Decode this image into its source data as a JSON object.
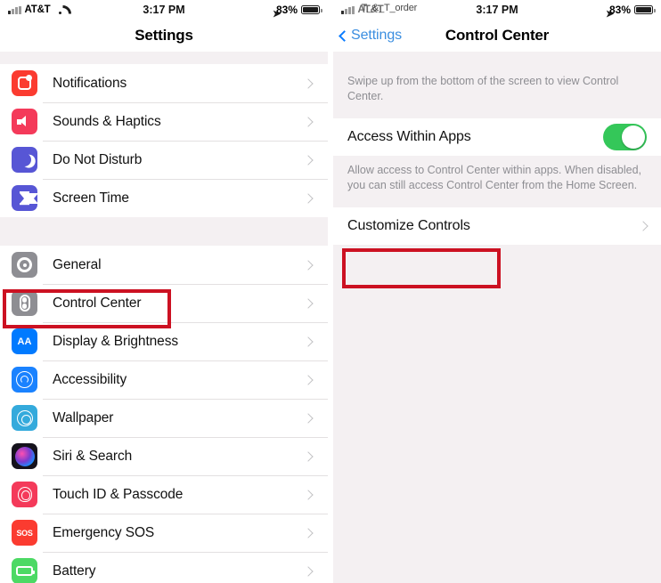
{
  "left": {
    "statusbar": {
      "carrier": "AT&T",
      "time": "3:17 PM",
      "battery_pct": "83%",
      "wifi_icon": "wifi-icon",
      "signal_icon": "cellular-signal-icon",
      "location_icon": "location-arrow-icon",
      "battery_icon": "battery-icon"
    },
    "nav": {
      "title": "Settings"
    },
    "groups": [
      {
        "rows": [
          {
            "label": "Notifications",
            "icon": "notifications-icon",
            "chevron": "chevron-right-icon"
          },
          {
            "label": "Sounds & Haptics",
            "icon": "sounds-icon",
            "chevron": "chevron-right-icon"
          },
          {
            "label": "Do Not Disturb",
            "icon": "do-not-disturb-icon",
            "chevron": "chevron-right-icon"
          },
          {
            "label": "Screen Time",
            "icon": "screen-time-icon",
            "chevron": "chevron-right-icon"
          }
        ]
      },
      {
        "rows": [
          {
            "label": "General",
            "icon": "general-gear-icon",
            "chevron": "chevron-right-icon"
          },
          {
            "label": "Control Center",
            "icon": "control-center-icon",
            "chevron": "chevron-right-icon"
          },
          {
            "label": "Display & Brightness",
            "icon": "display-aa-icon",
            "chevron": "chevron-right-icon"
          },
          {
            "label": "Accessibility",
            "icon": "accessibility-icon",
            "chevron": "chevron-right-icon"
          },
          {
            "label": "Wallpaper",
            "icon": "wallpaper-icon",
            "chevron": "chevron-right-icon"
          },
          {
            "label": "Siri & Search",
            "icon": "siri-icon",
            "chevron": "chevron-right-icon"
          },
          {
            "label": "Touch ID & Passcode",
            "icon": "touch-id-icon",
            "chevron": "chevron-right-icon"
          },
          {
            "label": "Emergency SOS",
            "icon": "emergency-sos-icon",
            "chevron": "chevron-right-icon"
          },
          {
            "label": "Battery",
            "icon": "battery-settings-icon",
            "chevron": "chevron-right-icon"
          }
        ]
      }
    ],
    "icon_text": {
      "display": "AA",
      "sos": "SOS"
    }
  },
  "right": {
    "statusbar": {
      "carrier": "AT&T",
      "carrier_overlay": "T_&_T_order",
      "time": "3:17 PM",
      "battery_pct": "83%"
    },
    "nav": {
      "back_label": "Settings",
      "title": "Control Center",
      "back_icon": "chevron-left-icon"
    },
    "footnote_top": "Swipe up from the bottom of the screen to view Control Center.",
    "access_row": {
      "label": "Access Within Apps",
      "toggle_state": "on"
    },
    "footnote_mid": "Allow access to Control Center within apps. When disabled, you can still access Control Center from the Home Screen.",
    "customize_row": {
      "label": "Customize Controls",
      "chevron": "chevron-right-icon"
    }
  },
  "annotations": {
    "highlight_color": "#cc1122",
    "boxes": [
      {
        "name": "control-center-highlight",
        "target": "Control Center"
      },
      {
        "name": "customize-controls-highlight",
        "target": "Customize Controls"
      }
    ]
  }
}
